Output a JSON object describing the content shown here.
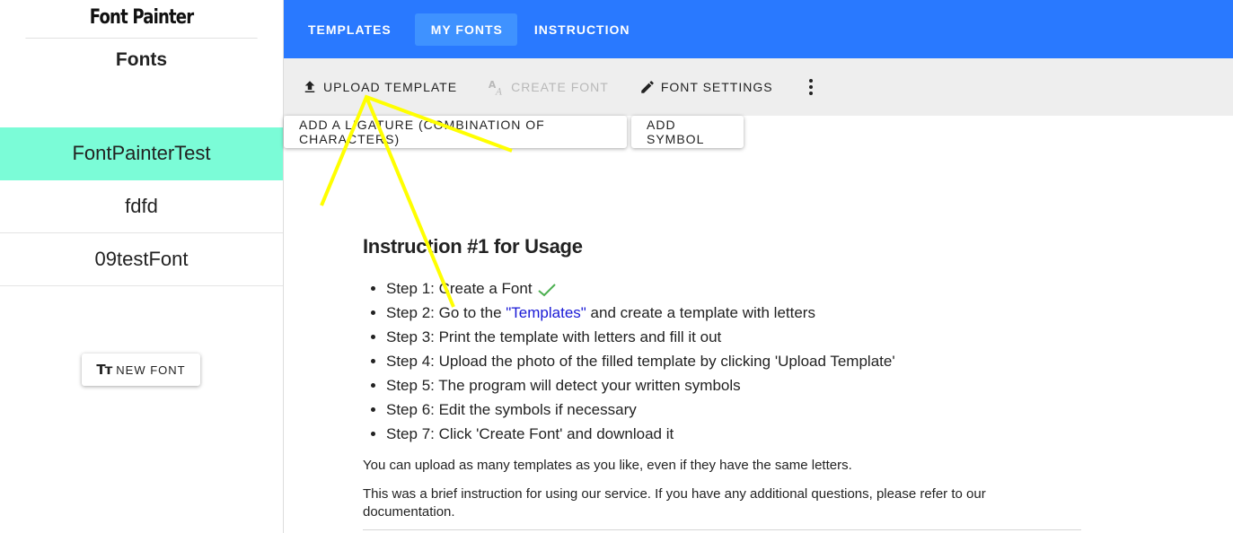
{
  "sidebar": {
    "brand": "Font Painter",
    "fonts_heading": "Fonts",
    "fonts": [
      "FontPainterTest",
      "fdfd",
      "09testFont"
    ],
    "new_font_icon": "Tт",
    "new_font_label": "NEW FONT"
  },
  "nav": {
    "tabs": [
      "TEMPLATES",
      "MY FONTS",
      "INSTRUCTION"
    ],
    "active": "MY FONTS",
    "accent": "#2979ff"
  },
  "toolbar": {
    "upload_template": "UPLOAD TEMPLATE",
    "create_font": "CREATE FONT",
    "font_settings": "FONT SETTINGS",
    "add_ligature": "ADD A LIGATURE (COMBINATION OF CHARACTERS)",
    "add_symbol": "ADD SYMBOL"
  },
  "instructions": {
    "title": "Instruction #1 for Usage",
    "step1": "Step 1: Create a Font",
    "step2_before": "Step 2: Go to the ",
    "step2_link": "\"Templates\"",
    "step2_after": " and create a template with letters",
    "step3": "Step 3: Print the template with letters and fill it out",
    "step4": "Step 4: Upload the photo of the filled template by clicking 'Upload Template'",
    "step5": "Step 5: The program will detect your written symbols",
    "step6": "Step 6: Edit the symbols if necessary",
    "step7": "Step 7: Click 'Create Font' and download it",
    "note1": "You can upload as many templates as you like, even if they have the same letters.",
    "note2": "This was a brief instruction for using our service. If you have any additional questions, please refer to our documentation."
  },
  "colors": {
    "active_font": "#7bfcd7",
    "annotation": "#ffff00",
    "check": "#4caf50"
  }
}
